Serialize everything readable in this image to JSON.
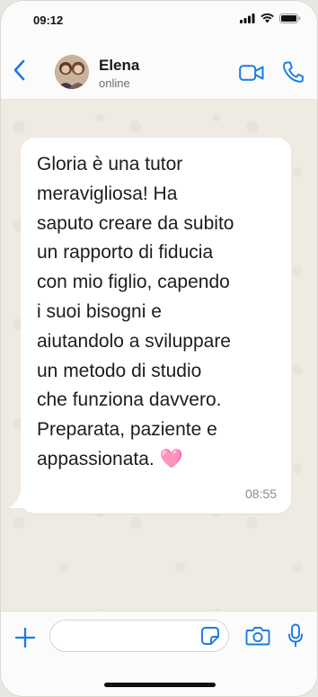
{
  "status_bar": {
    "time": "09:12"
  },
  "header": {
    "contact_name": "Elena",
    "contact_status": "online"
  },
  "message": {
    "text": "Gloria è una tutor\nmeravigliosa! Ha\nsaputo creare da subito\nun rapporto di fiducia\ncon mio figlio, capendo\ni suoi bisogni e\naiutandolo a sviluppare\nun metodo di studio\nche funziona davvero.\nPreparata, paziente e\nappassionata.",
    "emoji": "🩷",
    "time": "08:55"
  },
  "composer": {
    "input_value": ""
  },
  "icons": [
    "signal-icon",
    "wifi-icon",
    "battery-icon",
    "back-icon",
    "avatar",
    "video-call-icon",
    "phone-icon",
    "plus-icon",
    "sticker-icon",
    "camera-icon",
    "mic-icon"
  ],
  "colors": {
    "accent": "#1a7ce0",
    "chat_bg": "#efeae2",
    "bubble": "#ffffff"
  }
}
